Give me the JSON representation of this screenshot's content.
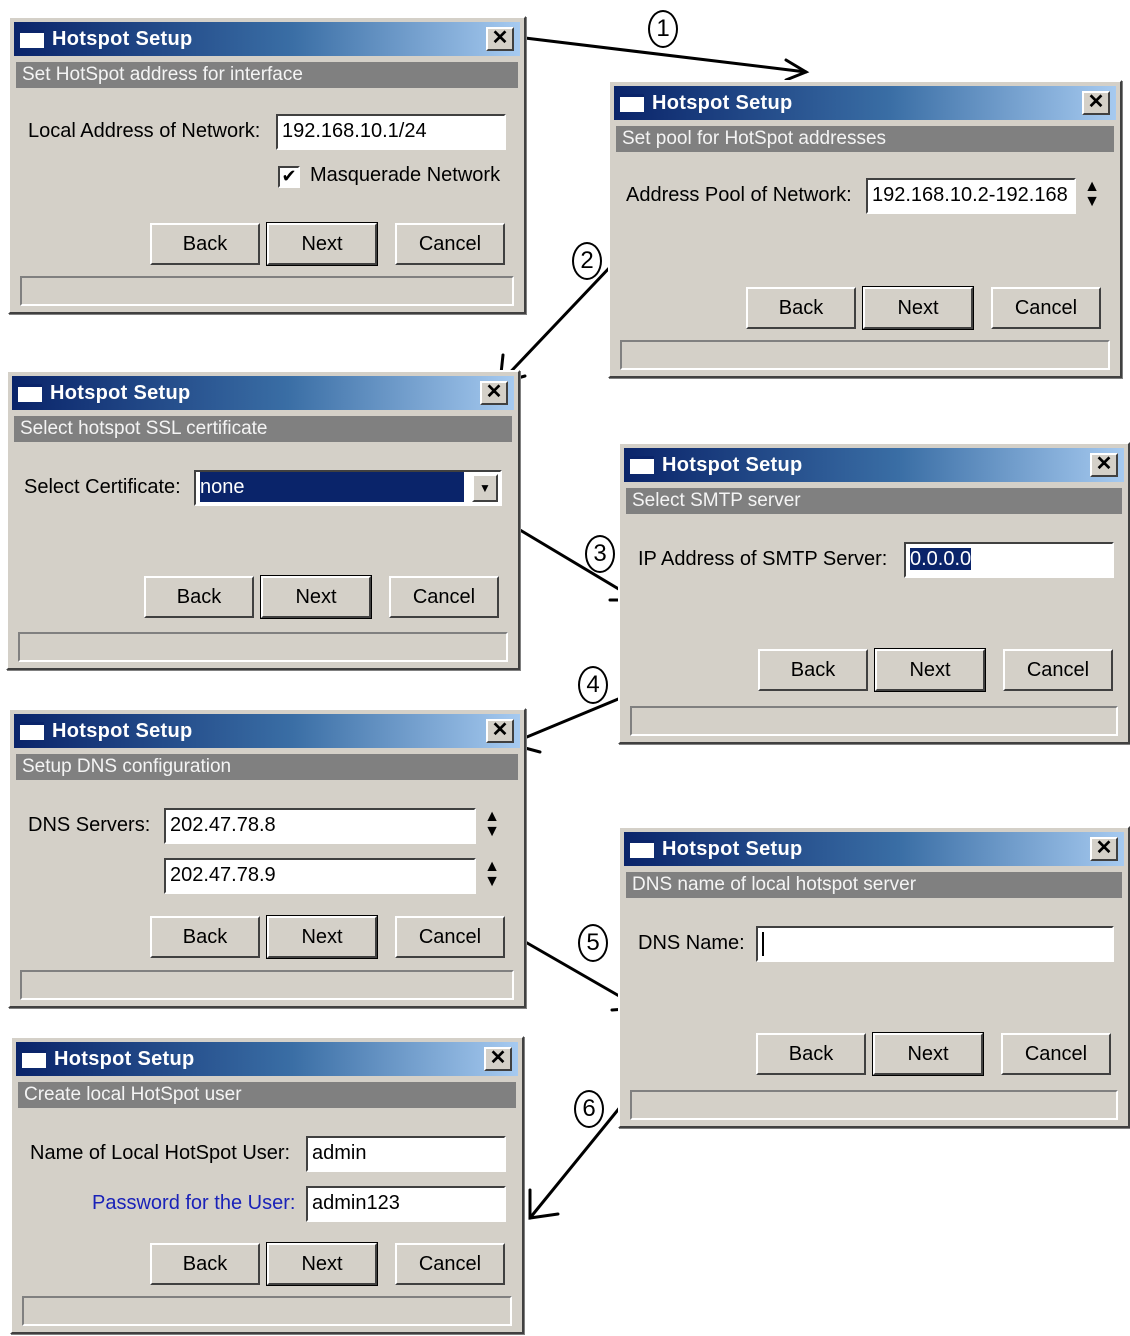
{
  "window_title": "Hotspot Setup",
  "close_glyph": "✕",
  "buttons": {
    "back": "Back",
    "next": "Next",
    "cancel": "Cancel"
  },
  "step_numbers": [
    "1",
    "2",
    "3",
    "4",
    "5",
    "6"
  ],
  "w1": {
    "subtitle": "Set HotSpot address for interface",
    "label": "Local Address of Network:",
    "value": "192.168.10.1/24",
    "checkbox_label": "Masquerade Network",
    "checkbox_checked": true
  },
  "w2": {
    "subtitle": "Set pool for HotSpot addresses",
    "label": "Address Pool of Network:",
    "value": "192.168.10.2-192.168"
  },
  "w3": {
    "subtitle": "Select hotspot SSL certificate",
    "label": "Select Certificate:",
    "value": "none"
  },
  "w4": {
    "subtitle": "Select SMTP server",
    "label": "IP Address of SMTP Server:",
    "value": "0.0.0.0"
  },
  "w5": {
    "subtitle": "Setup DNS configuration",
    "label": "DNS Servers:",
    "value1": "202.47.78.8",
    "value2": "202.47.78.9"
  },
  "w6": {
    "subtitle": "DNS name of local hotspot server",
    "label": "DNS Name:",
    "value": ""
  },
  "w7": {
    "subtitle": "Create local HotSpot user",
    "label_user": "Name of Local HotSpot User:",
    "value_user": "admin",
    "label_pass": "Password for the User:",
    "value_pass": "admin123"
  },
  "colors": {
    "title_dark": "#0a246a",
    "title_light": "#a6caf0",
    "window_bg": "#d4d0c8",
    "password_label": "#1a22b8"
  }
}
